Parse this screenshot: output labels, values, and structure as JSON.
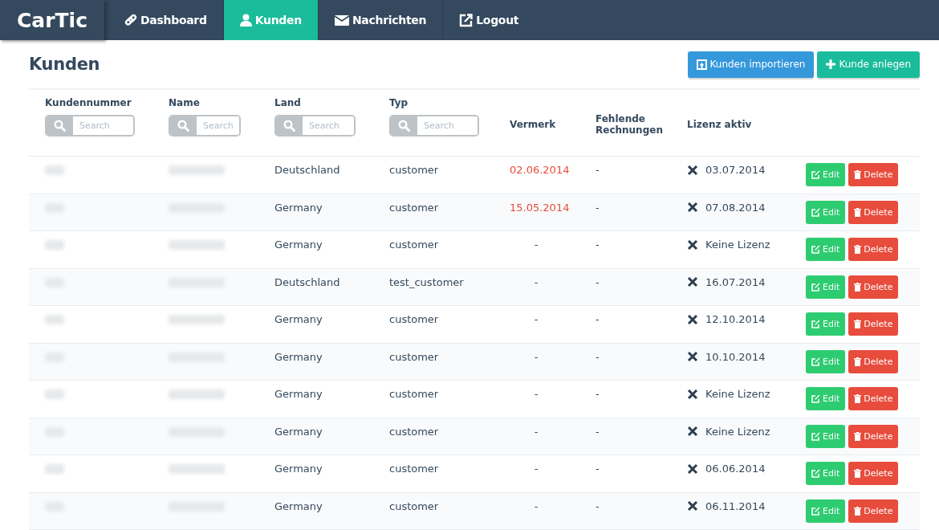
{
  "brand": "CarTic",
  "nav": [
    {
      "label": "Dashboard",
      "kind": "link",
      "selected": false
    },
    {
      "label": "Kunden",
      "kind": "user",
      "selected": true
    },
    {
      "label": "Nachrichten",
      "kind": "mail",
      "selected": false
    },
    {
      "label": "Logout",
      "kind": "external",
      "selected": false
    }
  ],
  "page_title": "Kunden",
  "actions": [
    {
      "label": "Kunden importieren",
      "kind": "import"
    },
    {
      "label": "Kunde anlegen",
      "kind": "add"
    }
  ],
  "columns": [
    {
      "label": "Kundennummer",
      "search_placeholder": "Search"
    },
    {
      "label": "Name",
      "search_placeholder": "Search"
    },
    {
      "label": "Land",
      "search_placeholder": "Search"
    },
    {
      "label": "Typ",
      "search_placeholder": "Search"
    },
    {
      "label": "Vermerk"
    },
    {
      "label": "Fehlende Rechnungen"
    },
    {
      "label": "Lizenz aktiv"
    }
  ],
  "rows": [
    {
      "land": "Deutschland",
      "typ": "customer",
      "vermerk": "02.06.2014",
      "vermerk_alert": true,
      "fehlende": "-",
      "license_active": false,
      "lizenz": "03.07.2014",
      "edit": "Edit",
      "delete": "Delete"
    },
    {
      "land": "Germany",
      "typ": "customer",
      "vermerk": "15.05.2014",
      "vermerk_alert": true,
      "fehlende": "-",
      "license_active": false,
      "lizenz": "07.08.2014",
      "edit": "Edit",
      "delete": "Delete"
    },
    {
      "land": "Germany",
      "typ": "customer",
      "vermerk": "-",
      "vermerk_alert": false,
      "fehlende": "-",
      "license_active": false,
      "lizenz": "Keine Lizenz",
      "edit": "Edit",
      "delete": "Delete"
    },
    {
      "land": "Deutschland",
      "typ": "test_customer",
      "vermerk": "-",
      "vermerk_alert": false,
      "fehlende": "-",
      "license_active": false,
      "lizenz": "16.07.2014",
      "edit": "Edit",
      "delete": "Delete"
    },
    {
      "land": "Germany",
      "typ": "customer",
      "vermerk": "-",
      "vermerk_alert": false,
      "fehlende": "-",
      "license_active": false,
      "lizenz": "12.10.2014",
      "edit": "Edit",
      "delete": "Delete"
    },
    {
      "land": "Germany",
      "typ": "customer",
      "vermerk": "-",
      "vermerk_alert": false,
      "fehlende": "-",
      "license_active": false,
      "lizenz": "10.10.2014",
      "edit": "Edit",
      "delete": "Delete"
    },
    {
      "land": "Germany",
      "typ": "customer",
      "vermerk": "-",
      "vermerk_alert": false,
      "fehlende": "-",
      "license_active": false,
      "lizenz": "Keine Lizenz",
      "edit": "Edit",
      "delete": "Delete"
    },
    {
      "land": "Germany",
      "typ": "customer",
      "vermerk": "-",
      "vermerk_alert": false,
      "fehlende": "-",
      "license_active": false,
      "lizenz": "Keine Lizenz",
      "edit": "Edit",
      "delete": "Delete"
    },
    {
      "land": "Germany",
      "typ": "customer",
      "vermerk": "-",
      "vermerk_alert": false,
      "fehlende": "-",
      "license_active": false,
      "lizenz": "06.06.2014",
      "edit": "Edit",
      "delete": "Delete"
    },
    {
      "land": "Germany",
      "typ": "customer",
      "vermerk": "-",
      "vermerk_alert": false,
      "fehlende": "-",
      "license_active": false,
      "lizenz": "06.11.2014",
      "edit": "Edit",
      "delete": "Delete"
    }
  ]
}
